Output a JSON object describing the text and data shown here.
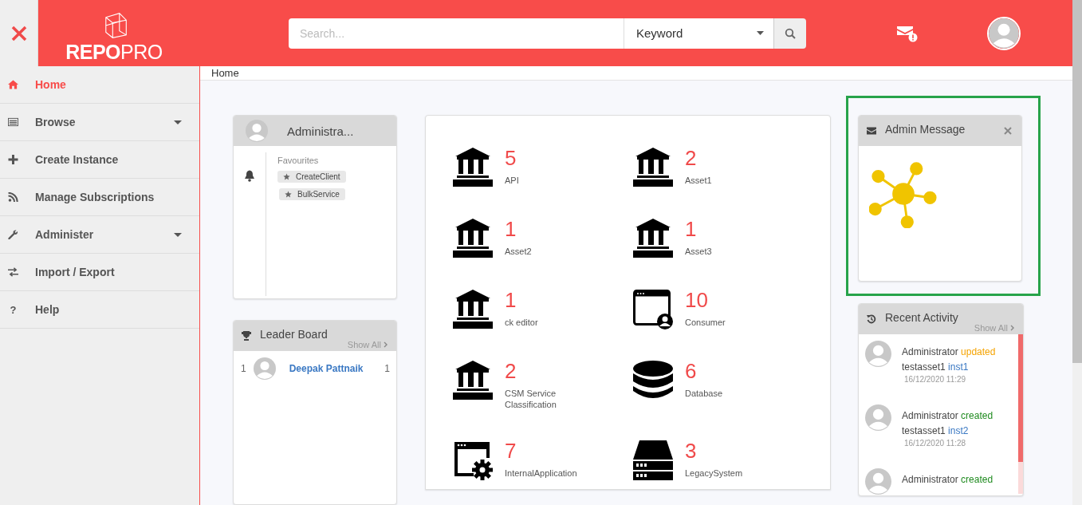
{
  "header": {
    "logo": "**REPO**PRO",
    "search": {
      "placeholder": "Search..."
    },
    "filter": {
      "value": "Keyword"
    }
  },
  "sidebar": {
    "items": [
      {
        "label": "Home",
        "selected": true,
        "expandable": false
      },
      {
        "label": "Browse",
        "selected": false,
        "expandable": true
      },
      {
        "label": "Create Instance",
        "selected": false,
        "expandable": false
      },
      {
        "label": "Manage Subscriptions",
        "selected": false,
        "expandable": false
      },
      {
        "label": "Administer",
        "selected": false,
        "expandable": true
      },
      {
        "label": "Import / Export",
        "selected": false,
        "expandable": false
      },
      {
        "label": "Help",
        "glyph": "?",
        "selected": false,
        "expandable": false
      }
    ]
  },
  "breadcrumb": "Home",
  "profile_card": {
    "name": "Administra...",
    "favourites_label": "Favourites",
    "favourites": [
      "CreateClient",
      "BulkService"
    ]
  },
  "leader_board": {
    "title": "Leader Board",
    "show_all": "Show All",
    "rows": [
      {
        "rank": "1",
        "name": "Deepak Pattnaik",
        "score": "1"
      }
    ]
  },
  "asset_tiles": [
    {
      "kind": "bank",
      "count": "5",
      "label": "API"
    },
    {
      "kind": "bank",
      "count": "2",
      "label": "Asset1"
    },
    {
      "kind": "bank",
      "count": "1",
      "label": "Asset2"
    },
    {
      "kind": "bank",
      "count": "1",
      "label": "Asset3"
    },
    {
      "kind": "bank",
      "count": "1",
      "label": "ck editor"
    },
    {
      "kind": "window-user",
      "count": "10",
      "label": "Consumer"
    },
    {
      "kind": "bank",
      "count": "2",
      "label": "CSM Service Classification"
    },
    {
      "kind": "database",
      "count": "6",
      "label": "Database"
    },
    {
      "kind": "window-gear",
      "count": "7",
      "label": "InternalApplication"
    },
    {
      "kind": "server",
      "count": "3",
      "label": "LegacySystem"
    }
  ],
  "admin_message": {
    "title": "Admin Message"
  },
  "recent_activity": {
    "title": "Recent Activity",
    "show_all": "Show All",
    "items": [
      {
        "user": "Administrator",
        "action": "updated",
        "color": "#f5a300",
        "asset": "testasset1",
        "instance": "inst1",
        "time": "16/12/2020 11:29"
      },
      {
        "user": "Administrator",
        "action": "created",
        "color": "#1e8a1e",
        "asset": "testasset1",
        "instance": "inst2",
        "time": "16/12/2020 11:28"
      },
      {
        "user": "Administrator",
        "action": "created",
        "color": "#1e8a1e"
      }
    ]
  }
}
